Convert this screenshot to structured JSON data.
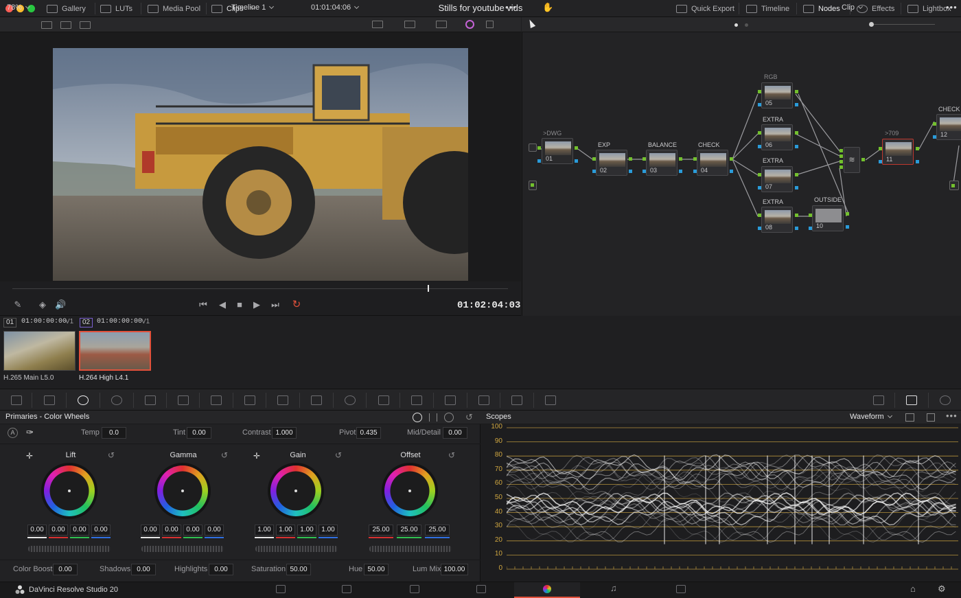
{
  "titlebar": {
    "left_items": [
      {
        "icon": "gallery-icon",
        "label": "Gallery"
      },
      {
        "icon": "luts-icon",
        "label": "LUTs"
      },
      {
        "icon": "media-pool-icon",
        "label": "Media Pool"
      },
      {
        "icon": "clips-icon",
        "label": "Clips"
      }
    ],
    "title": "Stills for youtube vids",
    "right_items": [
      {
        "icon": "quick-export-icon",
        "label": "Quick Export"
      },
      {
        "icon": "timeline-icon",
        "label": "Timeline"
      },
      {
        "icon": "nodes-icon",
        "label": "Nodes"
      },
      {
        "icon": "fx-icon",
        "label": "Effects"
      },
      {
        "icon": "lightbox-icon",
        "label": "Lightbox"
      }
    ]
  },
  "viewer_bar": {
    "zoom": "78%",
    "timeline": "Timeline 1",
    "timecode": "01:01:04:06"
  },
  "node_bar": {
    "mode": "Clip"
  },
  "viewer": {
    "timecode": "01:02:04:03",
    "playhead_fraction": 0.84
  },
  "nodes": {
    "input_label": ">DWG",
    "items": [
      {
        "num": "01",
        "label": ""
      },
      {
        "num": "02",
        "label": "EXP"
      },
      {
        "num": "03",
        "label": "BALANCE"
      },
      {
        "num": "04",
        "label": "CHECK"
      },
      {
        "num": "05",
        "label": "RGB"
      },
      {
        "num": "06",
        "label": "EXTRA"
      },
      {
        "num": "07",
        "label": "EXTRA"
      },
      {
        "num": "08",
        "label": "EXTRA"
      },
      {
        "num": "10",
        "label": "OUTSIDE"
      },
      {
        "num": "11",
        "label": ">709"
      },
      {
        "num": "12",
        "label": "CHECK"
      }
    ]
  },
  "clips": [
    {
      "index": "01",
      "timecode": "01:00:00:00",
      "track": "V1",
      "codec": "H.265 Main L5.0"
    },
    {
      "index": "02",
      "timecode": "01:00:00:00",
      "track": "V1",
      "codec": "H.264 High L4.1"
    }
  ],
  "primaries": {
    "title": "Primaries - Color Wheels",
    "params_top": [
      {
        "label": "Temp",
        "value": "0.0"
      },
      {
        "label": "Tint",
        "value": "0.00"
      },
      {
        "label": "Contrast",
        "value": "1.000"
      },
      {
        "label": "Pivot",
        "value": "0.435"
      },
      {
        "label": "Mid/Detail",
        "value": "0.00"
      }
    ],
    "wheels": [
      {
        "name": "Lift",
        "values": [
          "0.00",
          "0.00",
          "0.00",
          "0.00"
        ]
      },
      {
        "name": "Gamma",
        "values": [
          "0.00",
          "0.00",
          "0.00",
          "0.00"
        ]
      },
      {
        "name": "Gain",
        "values": [
          "1.00",
          "1.00",
          "1.00",
          "1.00"
        ]
      },
      {
        "name": "Offset",
        "values": [
          "25.00",
          "25.00",
          "25.00"
        ]
      }
    ],
    "params_bottom": [
      {
        "label": "Color Boost",
        "value": "0.00"
      },
      {
        "label": "Shadows",
        "value": "0.00"
      },
      {
        "label": "Highlights",
        "value": "0.00"
      },
      {
        "label": "Saturation",
        "value": "50.00"
      },
      {
        "label": "Hue",
        "value": "50.00"
      },
      {
        "label": "Lum Mix",
        "value": "100.00"
      }
    ]
  },
  "scopes": {
    "title": "Scopes",
    "mode": "Waveform",
    "y_ticks": [
      "100",
      "90",
      "80",
      "70",
      "60",
      "50",
      "40",
      "30",
      "20",
      "10",
      "0"
    ]
  },
  "app": {
    "name": "DaVinci Resolve Studio 20"
  },
  "colors": {
    "accent": "#e2513b",
    "node_green": "#73c02e",
    "node_blue": "#2a9bd9",
    "scope_line": "#cfa640"
  }
}
